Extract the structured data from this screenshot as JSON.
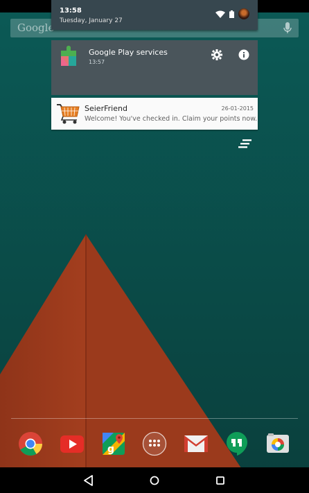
{
  "status": {
    "time": "13:58",
    "date": "Tuesday, January 27"
  },
  "search": {
    "placeholder": "Google"
  },
  "notifications": [
    {
      "app": "Google Play services",
      "time": "13:57",
      "icon": "google-play-services-icon"
    },
    {
      "app": "SeierFriend",
      "date": "26-01-2015",
      "message": "Welcome! You've checked in. Claim your points now.",
      "icon": "shopping-cart-icon"
    }
  ],
  "dock": {
    "apps": [
      "Chrome",
      "YouTube",
      "Maps",
      "App drawer",
      "Gmail",
      "Hangouts",
      "Camera"
    ]
  },
  "colors": {
    "wallpaper_teal": "#0d4f4c",
    "pyramid": "#a03c1d",
    "shade": "#37474f",
    "notification_dark": "#4a555b"
  }
}
